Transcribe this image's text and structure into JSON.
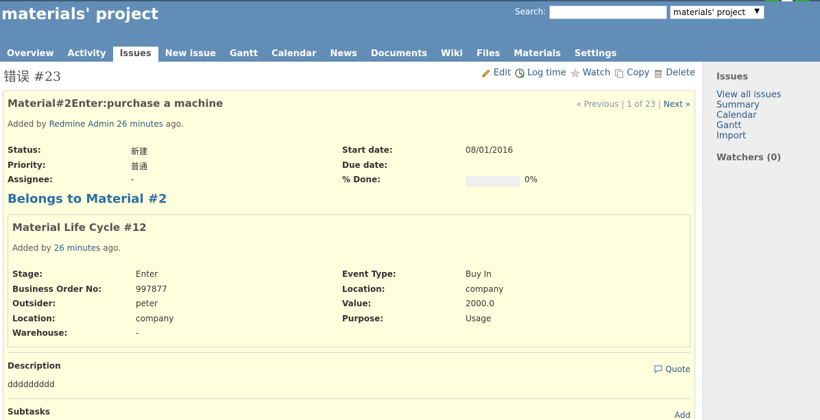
{
  "header": {
    "project_title": "materials' project",
    "search_label": "Search:",
    "search_value": "",
    "project_jump_value": "materials' project"
  },
  "menu": [
    {
      "label": "Overview"
    },
    {
      "label": "Activity"
    },
    {
      "label": "Issues",
      "selected": true
    },
    {
      "label": "New issue"
    },
    {
      "label": "Gantt"
    },
    {
      "label": "Calendar"
    },
    {
      "label": "News"
    },
    {
      "label": "Documents"
    },
    {
      "label": "Wiki"
    },
    {
      "label": "Files"
    },
    {
      "label": "Materials"
    },
    {
      "label": "Settings"
    }
  ],
  "issue": {
    "heading": "错误 #23",
    "subject": "Material#2Enter:purchase a machine",
    "added_by_prefix": "Added by",
    "author": "Redmine Admin",
    "time_ago": "26 minutes",
    "added_suffix": "ago.",
    "prev_label": "« Previous",
    "position": "1 of 23",
    "next_label": "Next »",
    "attributes_left": [
      {
        "label": "Status:",
        "value": "新建"
      },
      {
        "label": "Priority:",
        "value": "普通"
      },
      {
        "label": "Assignee:",
        "value": "-"
      }
    ],
    "attributes_right": [
      {
        "label": "Start date:",
        "value": "08/01/2016"
      },
      {
        "label": "Due date:",
        "value": ""
      },
      {
        "label": "% Done:",
        "value": "0%"
      }
    ],
    "done_fraction": 0
  },
  "actions": {
    "edit": "Edit",
    "log_time": "Log time",
    "watch": "Watch",
    "copy": "Copy",
    "delete": "Delete"
  },
  "material": {
    "belongs_to": "Belongs to Material #2",
    "title": "Material Life Cycle #12",
    "added_by_prefix": "Added by",
    "time_ago": "26 minutes",
    "added_suffix": "ago.",
    "fields_left": [
      {
        "label": "Stage:",
        "value": "Enter"
      },
      {
        "label": "Business Order No:",
        "value": "997877"
      },
      {
        "label": "Outsider:",
        "value": "peter"
      },
      {
        "label": "Location:",
        "value": "company"
      },
      {
        "label": "Warehouse:",
        "value": "-"
      }
    ],
    "fields_right": [
      {
        "label": "Event Type:",
        "value": "Buy In"
      },
      {
        "label": "Location:",
        "value": "company"
      },
      {
        "label": "Value:",
        "value": "2000.0"
      },
      {
        "label": "Purpose:",
        "value": "Usage"
      }
    ]
  },
  "description": {
    "title": "Description",
    "quote_label": "Quote",
    "text": "ddddddddd"
  },
  "subtasks": {
    "title": "Subtasks",
    "add_label": "Add"
  },
  "sidebar": {
    "issues_title": "Issues",
    "links": [
      "View all issues",
      "Summary",
      "Calendar",
      "Gantt",
      "Import"
    ],
    "watchers_title": "Watchers (0)"
  },
  "colors": {
    "header_bg": "#628db6",
    "issue_bg": "#ffffdd",
    "link": "#2a5a8a",
    "belongs_heading": "#2a6fa8"
  },
  "icons": [
    "edit-icon",
    "log-time-icon",
    "watch-icon",
    "copy-icon",
    "delete-icon",
    "quote-icon"
  ]
}
